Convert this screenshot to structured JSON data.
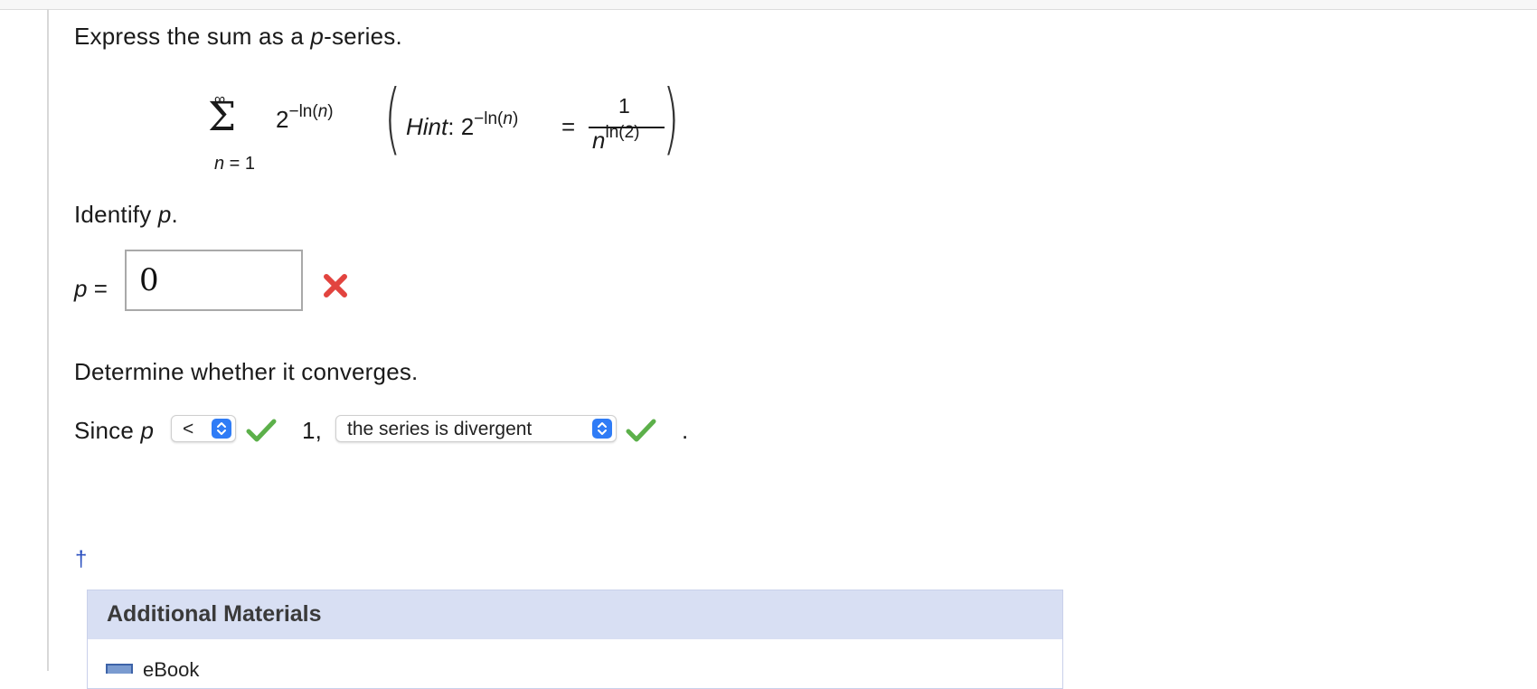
{
  "question": {
    "intro": {
      "pre": "Express the sum as a ",
      "var": "p",
      "post": "-series."
    },
    "sum": {
      "upper": "∞",
      "symbol": "Σ",
      "lower_var": "n",
      "lower_rest": " = 1",
      "term_base": "2",
      "term_exp_pre": "−ln(",
      "term_exp_var": "n",
      "term_exp_post": ")"
    },
    "hint": {
      "label": "Hint",
      "colon": ": ",
      "base": "2",
      "exp_pre": "−ln(",
      "exp_var": "n",
      "exp_post": ")",
      "equals": "=",
      "numerator": "1",
      "den_var": "n",
      "den_exp": "ln(2)"
    }
  },
  "identify": {
    "pre": "Identify ",
    "var": "p",
    "post": ".",
    "label_var": "p",
    "label_eq": " =",
    "answer_value": "0",
    "answer_status": "incorrect"
  },
  "converge": {
    "heading": "Determine whether it converges.",
    "since": "Since ",
    "since_var": "p",
    "compare_select": "<",
    "compare_status": "correct",
    "one": "1,",
    "result_select": "the series is divergent",
    "result_status": "correct",
    "end": "."
  },
  "footnote_marker": "†",
  "additional_materials": {
    "title": "Additional Materials",
    "ebook_label": "eBook"
  },
  "colors": {
    "wrong_red": "#e2443f",
    "check_green": "#5cb04a",
    "select_arrow_blue": "#2f7cf6",
    "materials_header": "#d8dff3"
  },
  "icons": {
    "wrong": "x-mark-icon",
    "correct": "check-mark-icon",
    "select": "updown-chevron-icon",
    "ebook": "book-icon"
  }
}
